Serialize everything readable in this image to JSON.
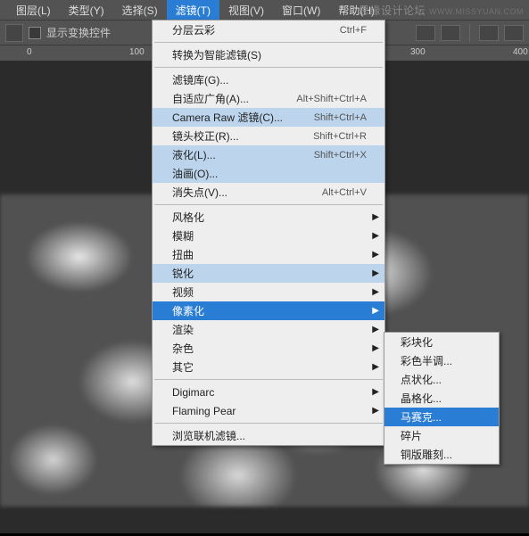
{
  "menubar": {
    "items": [
      "图层(L)",
      "类型(Y)",
      "选择(S)",
      "滤镜(T)",
      "视图(V)",
      "窗口(W)",
      "帮助(H)"
    ],
    "active_index": 3
  },
  "toolbar": {
    "checkbox_label": "显示变换控件"
  },
  "ruler": {
    "marks": [
      "0",
      "100",
      "300",
      "400"
    ]
  },
  "dropdown": [
    {
      "type": "item",
      "label": "分层云彩",
      "shortcut": "Ctrl+F"
    },
    {
      "type": "sep"
    },
    {
      "type": "item",
      "label": "转换为智能滤镜(S)"
    },
    {
      "type": "sep"
    },
    {
      "type": "item",
      "label": "滤镜库(G)..."
    },
    {
      "type": "item",
      "label": "自适应广角(A)...",
      "shortcut": "Alt+Shift+Ctrl+A"
    },
    {
      "type": "item",
      "label": "Camera Raw 滤镜(C)...",
      "shortcut": "Shift+Ctrl+A",
      "recent": true
    },
    {
      "type": "item",
      "label": "镜头校正(R)...",
      "shortcut": "Shift+Ctrl+R"
    },
    {
      "type": "item",
      "label": "液化(L)...",
      "shortcut": "Shift+Ctrl+X",
      "recent": true
    },
    {
      "type": "item",
      "label": "油画(O)...",
      "recent": true
    },
    {
      "type": "item",
      "label": "消失点(V)...",
      "shortcut": "Alt+Ctrl+V"
    },
    {
      "type": "sep"
    },
    {
      "type": "item",
      "label": "风格化",
      "submenu": true
    },
    {
      "type": "item",
      "label": "模糊",
      "submenu": true
    },
    {
      "type": "item",
      "label": "扭曲",
      "submenu": true
    },
    {
      "type": "item",
      "label": "锐化",
      "submenu": true,
      "recent": true
    },
    {
      "type": "item",
      "label": "视频",
      "submenu": true
    },
    {
      "type": "item",
      "label": "像素化",
      "submenu": true,
      "hover": true
    },
    {
      "type": "item",
      "label": "渲染",
      "submenu": true
    },
    {
      "type": "item",
      "label": "杂色",
      "submenu": true
    },
    {
      "type": "item",
      "label": "其它",
      "submenu": true
    },
    {
      "type": "sep"
    },
    {
      "type": "item",
      "label": "Digimarc",
      "submenu": true
    },
    {
      "type": "item",
      "label": "Flaming Pear",
      "submenu": true
    },
    {
      "type": "sep"
    },
    {
      "type": "item",
      "label": "浏览联机滤镜..."
    }
  ],
  "submenu": [
    {
      "label": "彩块化"
    },
    {
      "label": "彩色半调..."
    },
    {
      "label": "点状化..."
    },
    {
      "label": "晶格化..."
    },
    {
      "label": "马赛克...",
      "hover": true
    },
    {
      "label": "碎片"
    },
    {
      "label": "铜版雕刻..."
    }
  ],
  "watermark": {
    "text": "思缘设计论坛",
    "url": "WWW.MISSYUAN.COM"
  }
}
